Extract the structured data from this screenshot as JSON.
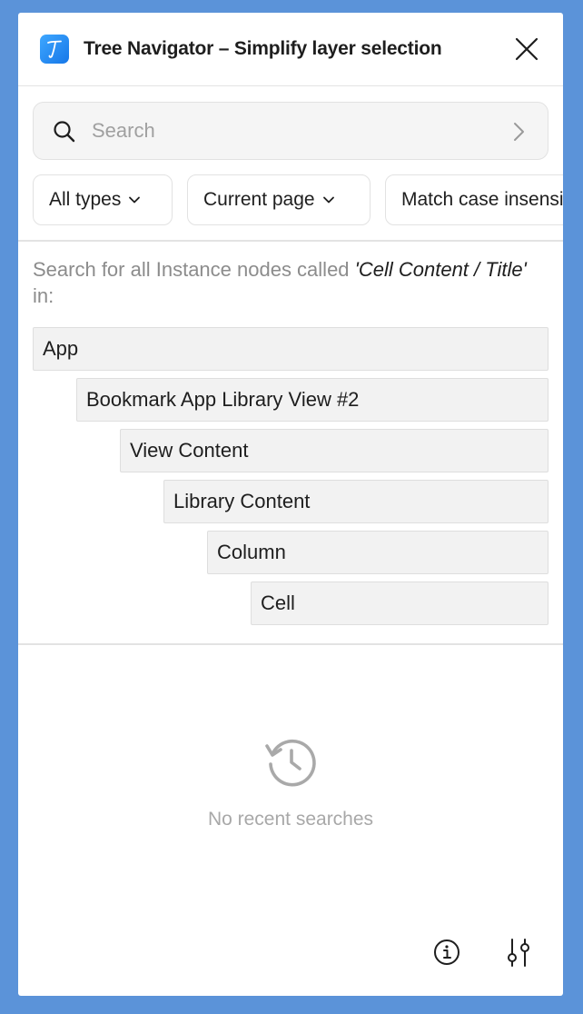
{
  "header": {
    "title": "Tree Navigator – Simplify layer selection",
    "icon": "plugin-logo-icon",
    "close_icon": "close-icon",
    "accent": "#1677e8"
  },
  "search": {
    "placeholder": "Search",
    "value": ""
  },
  "filters": [
    {
      "label": "All types"
    },
    {
      "label": "Current page"
    },
    {
      "label": "Match case insensitive"
    }
  ],
  "description": {
    "prefix": "Search for all Instance nodes called ",
    "query": "'Cell Content / Title'",
    "suffix": " in:"
  },
  "tree": [
    {
      "label": "App",
      "depth": 0
    },
    {
      "label": "Bookmark App Library View #2",
      "depth": 1
    },
    {
      "label": "View Content",
      "depth": 2
    },
    {
      "label": "Library Content",
      "depth": 3
    },
    {
      "label": "Column",
      "depth": 4
    },
    {
      "label": "Cell",
      "depth": 5
    }
  ],
  "recent": {
    "empty_text": "No recent searches",
    "icon": "history-icon"
  },
  "footer": {
    "info_icon": "info-icon",
    "settings_icon": "sliders-icon"
  }
}
